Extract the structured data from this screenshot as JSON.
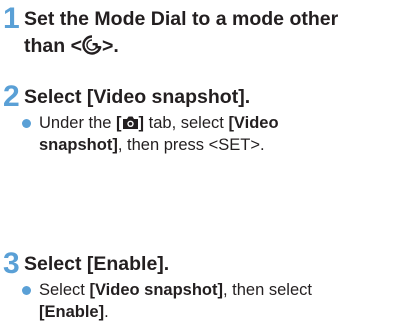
{
  "steps": [
    {
      "number": "1",
      "title_line1": "Set the Mode Dial to a mode other",
      "title_line2_prefix": "than <",
      "title_line2_suffix": ">."
    },
    {
      "number": "2",
      "title": "Select [Video snapshot].",
      "bullet": {
        "line1_prefix": "Under the ",
        "line1_bracket_open": "[",
        "line1_bracket_close": "]",
        "line1_middle": " tab, select ",
        "line1_bold_end": "[Video",
        "line2_bold_start": "snapshot]",
        "line2_rest": ", then press <SET>."
      }
    },
    {
      "number": "3",
      "title": "Select [Enable].",
      "bullet": {
        "line1_prefix": "Select ",
        "line1_bold": "[Video snapshot]",
        "line1_rest": ", then select",
        "line2_bold": "[Enable]",
        "line2_rest": "."
      }
    }
  ],
  "icons": {
    "mode_dial": "scene-intelligent-auto-icon",
    "shooting_tab": "camera-icon"
  },
  "colors": {
    "accent": "#5aa0d6",
    "text": "#231f20"
  }
}
